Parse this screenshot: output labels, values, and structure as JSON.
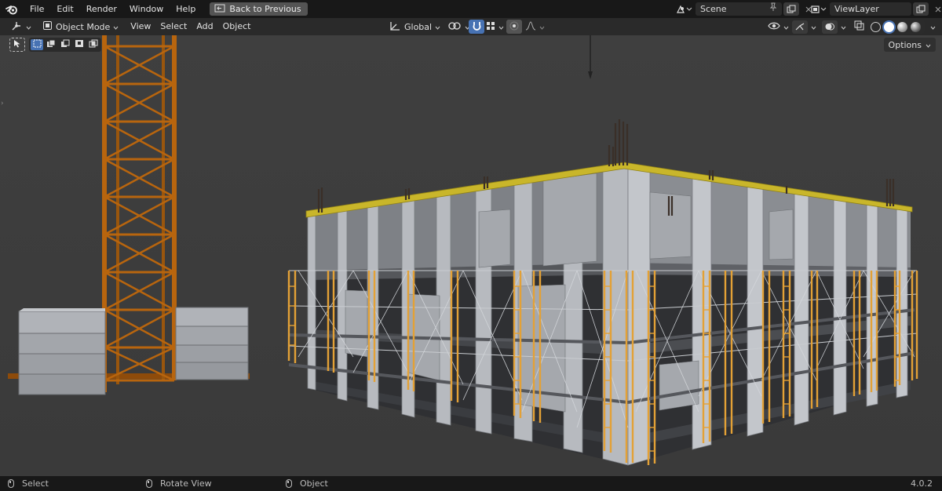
{
  "app": {
    "name": "Blender",
    "version": "4.0.2"
  },
  "menu": [
    "File",
    "Edit",
    "Render",
    "Window",
    "Help"
  ],
  "back_button": "Back to Previous",
  "scene": {
    "label": "Scene"
  },
  "view_layer": {
    "label": "ViewLayer"
  },
  "header": {
    "mode": "Object Mode",
    "menus": [
      "View",
      "Select",
      "Add",
      "Object"
    ],
    "transform_orientation": "Global",
    "options": "Options"
  },
  "status": {
    "select": "Select",
    "rotate": "Rotate View",
    "object": "Object",
    "version": "4.0.2"
  },
  "colors": {
    "crane": "#b8650e",
    "scaffold": "#e3a136",
    "slab_edge": "#c9b62a",
    "concrete": "#a9adb3",
    "accent_blue": "#4772b3"
  },
  "icons": [
    "blender-logo-icon",
    "back-icon",
    "scene-icon",
    "pin-icon",
    "copy-icon",
    "close-icon",
    "view-layer-icon",
    "editor-type-icon",
    "object-mode-icon",
    "orientation-icon",
    "pivot-icon",
    "snap-icon",
    "proportional-icon",
    "visibility-icon",
    "gizmo-icon",
    "overlay-icon",
    "xray-icon",
    "wireframe-shading-icon",
    "solid-shading-icon",
    "material-shading-icon",
    "rendered-shading-icon",
    "select-tool-icon",
    "mouse-icon"
  ]
}
